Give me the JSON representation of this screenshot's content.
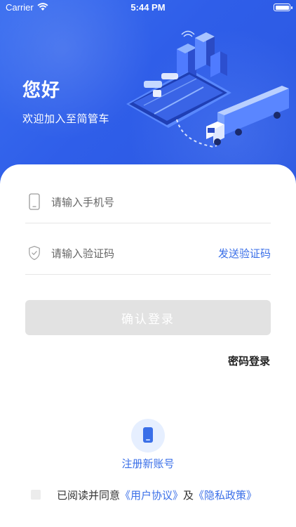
{
  "status_bar": {
    "carrier": "Carrier",
    "time": "5:44 PM"
  },
  "hero": {
    "greeting": "您好",
    "subtitle": "欢迎加入至简管车"
  },
  "form": {
    "phone_placeholder": "请输入手机号",
    "code_placeholder": "请输入验证码",
    "send_code_label": "发送验证码",
    "confirm_label": "确认登录",
    "password_login_label": "密码登录"
  },
  "register": {
    "label": "注册新账号"
  },
  "agreement": {
    "prefix": "已阅读并同意",
    "user_agreement": "《用户协议》",
    "conjunction": "及",
    "privacy_policy": "《隐私政策》"
  },
  "icons": {
    "phone_field": "mobile-phone-icon",
    "code_field": "shield-check-icon",
    "register": "mobile-phone-icon",
    "wifi": "wifi-icon",
    "battery": "battery-icon"
  },
  "colors": {
    "hero_blue": "#2f5ee9",
    "accent": "#3a6fe8",
    "button_disabled": "#e2e2e2"
  }
}
